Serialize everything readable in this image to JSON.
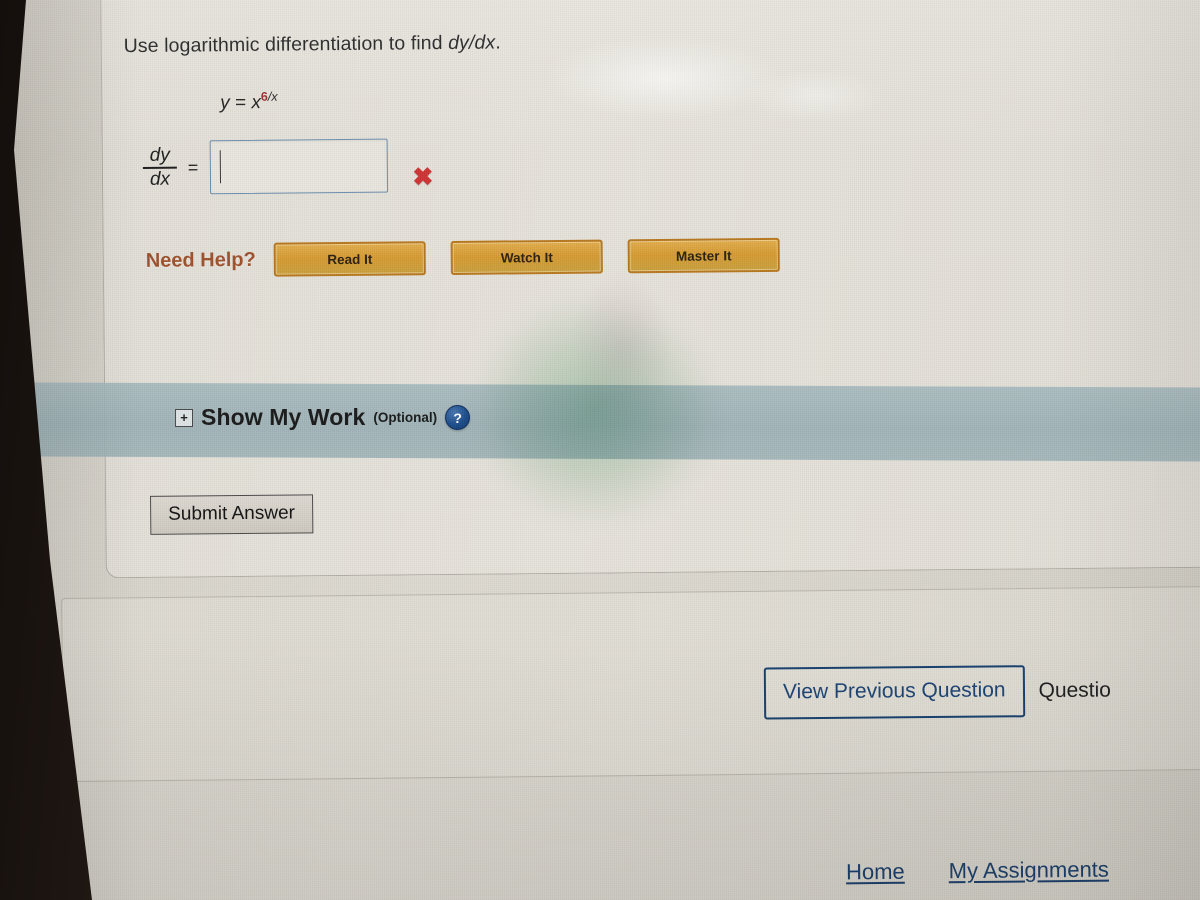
{
  "question": {
    "prompt_text": "Use logarithmic differentiation to find ",
    "prompt_italic": "dy/dx",
    "prompt_period": ".",
    "equation": {
      "lhs": "y",
      "equals": "=",
      "base": "x",
      "exponent_numerator": "6",
      "exponent_rest": "/x"
    },
    "answer": {
      "fraction_numerator": "dy",
      "fraction_denominator": "dx",
      "equals": "=",
      "value": "",
      "placeholder": "",
      "result_mark": "✖",
      "result_state": "incorrect"
    }
  },
  "need_help": {
    "label": "Need Help?",
    "buttons": [
      {
        "label": "Read It",
        "name": "read-it"
      },
      {
        "label": "Watch It",
        "name": "watch-it"
      },
      {
        "label": "Master It",
        "name": "master-it"
      }
    ]
  },
  "show_my_work": {
    "expander": "+",
    "title": "Show My Work",
    "optional": "(Optional)",
    "help_icon": "?"
  },
  "actions": {
    "submit_label": "Submit Answer"
  },
  "navigation": {
    "previous_label": "View Previous Question",
    "next_label": "Questio"
  },
  "footer": {
    "links": [
      {
        "label": "Home",
        "name": "home"
      },
      {
        "label": "My Assignments",
        "name": "my-assignments"
      }
    ]
  },
  "colors": {
    "help_button_fill": "#d79c33",
    "help_button_border": "#b9791f",
    "need_help_text": "#a0522d",
    "show_my_work_bar": "#a4b7bb",
    "answer_box_border": "#6d8fae",
    "incorrect_mark": "#cf3434",
    "link_navy": "#1b3f6b",
    "exponent_red": "#9e2b2b",
    "browser_chrome_navy": "#26417b"
  }
}
